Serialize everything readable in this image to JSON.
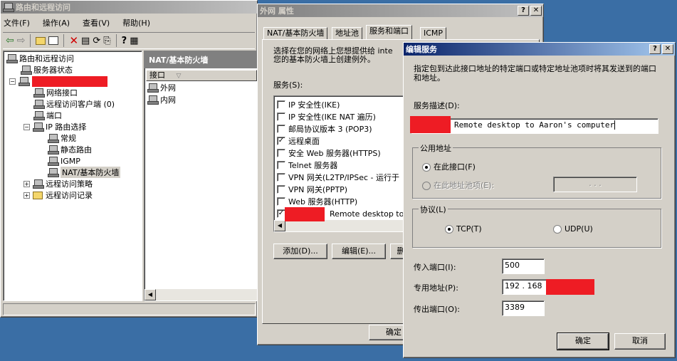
{
  "mmc": {
    "title": "路由和远程访问",
    "menu": [
      "文件(F)",
      "操作(A)",
      "查看(V)",
      "帮助(H)"
    ],
    "tree": {
      "root": "路由和远程访问",
      "server_status": "服务器状态",
      "items": [
        "网络接口",
        "远程访问客户端 (0)",
        "端口",
        "IP 路由选择",
        "常规",
        "静态路由",
        "IGMP",
        "NAT/基本防火墙",
        "远程访问策略",
        "远程访问记录"
      ]
    },
    "pane_header": "NAT/基本防火墙",
    "column_header": "接口",
    "interfaces": [
      "外网",
      "内网"
    ]
  },
  "props": {
    "title": "外网 属性",
    "tabs": [
      "NAT/基本防火墙",
      "地址池",
      "服务和端口",
      "ICMP"
    ],
    "intro": "选择在您的网络上您想提供给 inte\n您的基本防火墙上创建例外。",
    "services_label": "服务(S):",
    "services": [
      {
        "label": "IP 安全性(IKE)",
        "checked": false
      },
      {
        "label": "IP 安全性(IKE NAT 遍历)",
        "checked": false
      },
      {
        "label": "邮局协议版本 3 (POP3)",
        "checked": false
      },
      {
        "label": "远程桌面",
        "checked": true
      },
      {
        "label": "安全 Web 服务器(HTTPS)",
        "checked": false
      },
      {
        "label": "Telnet 服务器",
        "checked": false
      },
      {
        "label": "VPN 网关(L2TP/IPSec - 运行于",
        "checked": false
      },
      {
        "label": "VPN 网关(PPTP)",
        "checked": false
      },
      {
        "label": "Web 服务器(HTTP)",
        "checked": false
      },
      {
        "label": "Remote desktop to",
        "checked": true
      }
    ],
    "add_button": "添加(D)...",
    "edit_button": "编辑(E)...",
    "delete_button": "删",
    "ok_button": "确定"
  },
  "edit": {
    "title": "编辑服务",
    "description": "指定包到达此接口地址的特定端口或特定地址池项时将其发送到的端口和地址。",
    "desc_label": "服务描述(D):",
    "desc_value": "Remote desktop to Aaron's computer",
    "public_group": "公用地址",
    "radio_iface": "在此接口(F)",
    "radio_pool": "在此地址池项(E):",
    "pool_ip": ".   .   .",
    "protocol_group": "协议(L)",
    "tcp": "TCP(T)",
    "udp": "UDP(U)",
    "in_port_label": "传入端口(I):",
    "in_port": "500",
    "private_label": "专用地址(P):",
    "private_ip": "192 . 168",
    "out_port_label": "传出端口(O):",
    "out_port": "3389",
    "ok": "确定",
    "cancel": "取消"
  },
  "colors": {
    "redaction": "#ee1c24",
    "titlebar_active": "#0a246a"
  }
}
